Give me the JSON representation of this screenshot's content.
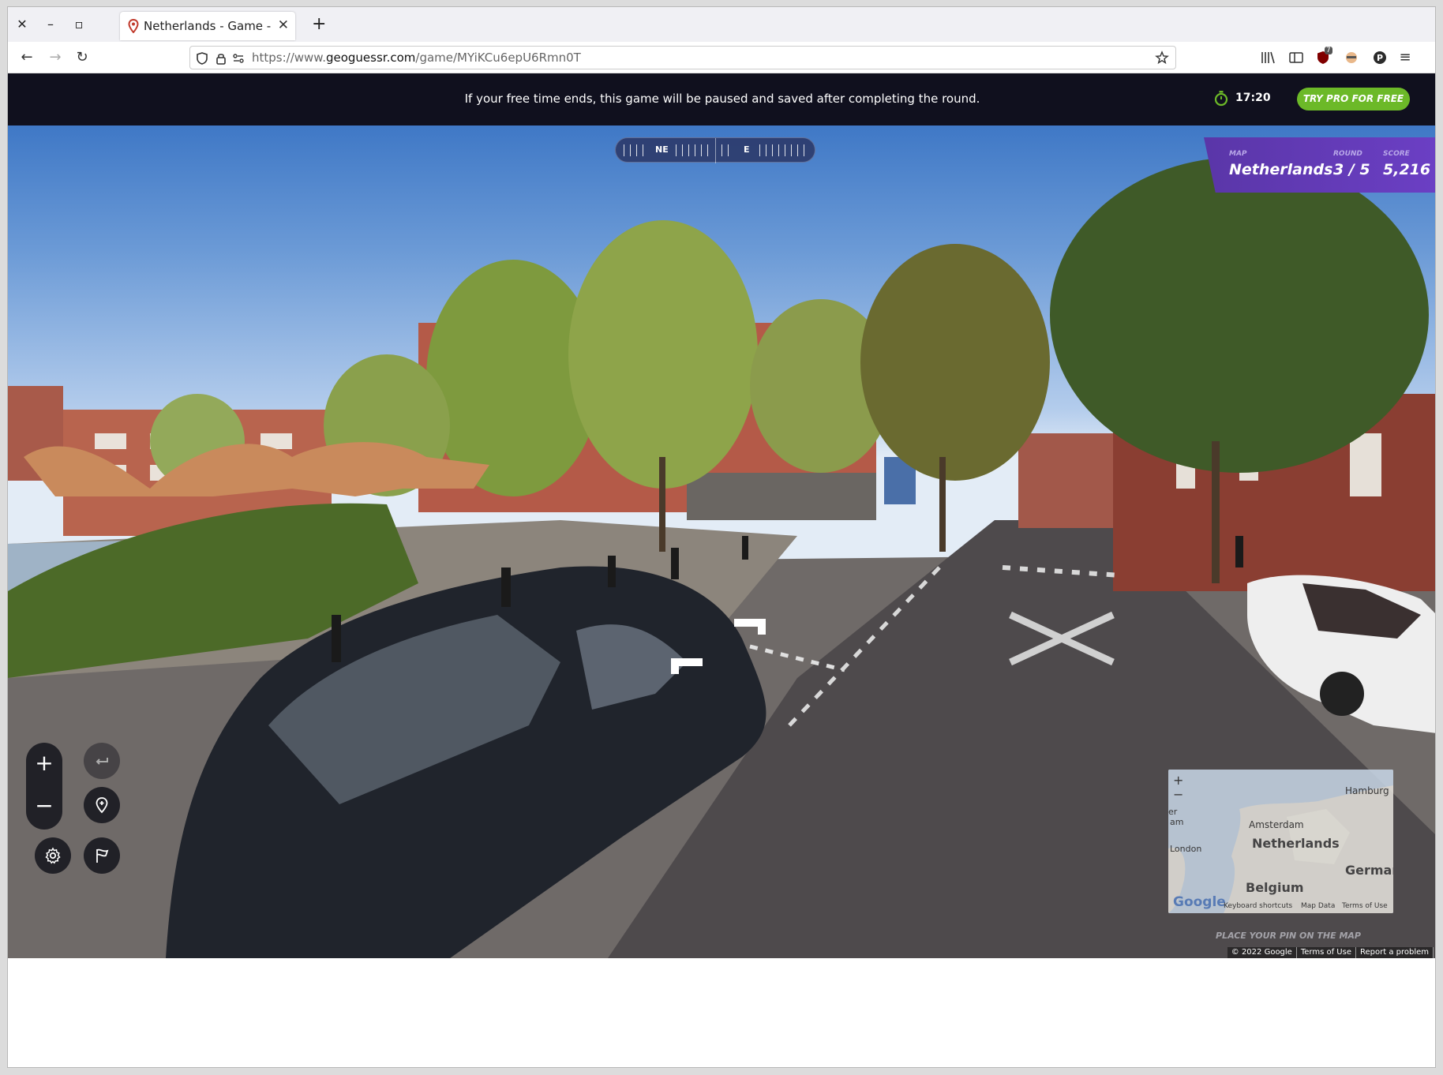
{
  "browser": {
    "tab_title": "Netherlands - Game - Ge",
    "url_prefix": "https://www.",
    "url_host": "geoguessr.com",
    "url_path": "/game/MYiKCu6epU6Rmn0T",
    "extension_badge": "7"
  },
  "banner": {
    "message": "If your free time ends, this game will be paused and saved after completing the round.",
    "timer": "17:20",
    "cta_label": "TRY PRO FOR FREE"
  },
  "compass": {
    "labels": [
      "NE",
      "E"
    ]
  },
  "status": {
    "map_label": "MAP",
    "map_value": "Netherlands",
    "round_label": "ROUND",
    "round_value": "3 / 5",
    "score_label": "SCORE",
    "score_value": "5,216"
  },
  "controls": {
    "zoom_in": "+",
    "zoom_out": "−"
  },
  "minimap": {
    "labels": {
      "hamburg": "Hamburg",
      "amsterdam": "Amsterdam",
      "netherlands": "Netherlands",
      "london": "London",
      "german": "German",
      "belgium": "Belgium",
      "am": "am",
      "er": "er"
    },
    "google": "Google",
    "footer": [
      "Keyboard shortcuts",
      "Map Data",
      "Terms of Use"
    ],
    "zoom_in": "+",
    "zoom_out": "−"
  },
  "hint": "PLACE YOUR PIN ON THE MAP",
  "streetview_footer": [
    "© 2022 Google",
    "Terms of Use",
    "Report a problem"
  ],
  "colors": {
    "banner_bg": "#10101e",
    "cta_green": "#6cb928",
    "status_purple": "#5a36a8"
  }
}
